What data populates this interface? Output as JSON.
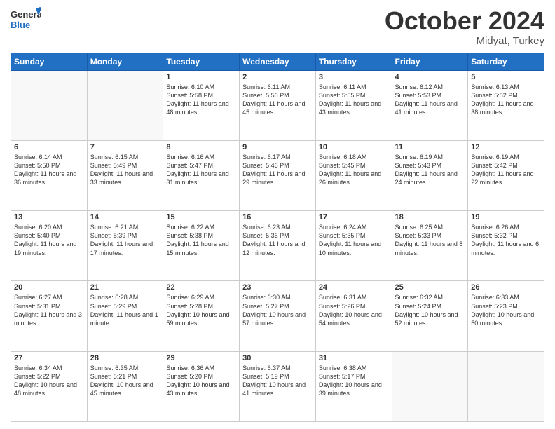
{
  "header": {
    "logo_general": "General",
    "logo_blue": "Blue",
    "month": "October 2024",
    "location": "Midyat, Turkey"
  },
  "days_of_week": [
    "Sunday",
    "Monday",
    "Tuesday",
    "Wednesday",
    "Thursday",
    "Friday",
    "Saturday"
  ],
  "weeks": [
    [
      {
        "day": "",
        "empty": true
      },
      {
        "day": "",
        "empty": true
      },
      {
        "day": "1",
        "sunrise": "6:10 AM",
        "sunset": "5:58 PM",
        "daylight": "11 hours and 48 minutes."
      },
      {
        "day": "2",
        "sunrise": "6:11 AM",
        "sunset": "5:56 PM",
        "daylight": "11 hours and 45 minutes."
      },
      {
        "day": "3",
        "sunrise": "6:11 AM",
        "sunset": "5:55 PM",
        "daylight": "11 hours and 43 minutes."
      },
      {
        "day": "4",
        "sunrise": "6:12 AM",
        "sunset": "5:53 PM",
        "daylight": "11 hours and 41 minutes."
      },
      {
        "day": "5",
        "sunrise": "6:13 AM",
        "sunset": "5:52 PM",
        "daylight": "11 hours and 38 minutes."
      }
    ],
    [
      {
        "day": "6",
        "sunrise": "6:14 AM",
        "sunset": "5:50 PM",
        "daylight": "11 hours and 36 minutes."
      },
      {
        "day": "7",
        "sunrise": "6:15 AM",
        "sunset": "5:49 PM",
        "daylight": "11 hours and 33 minutes."
      },
      {
        "day": "8",
        "sunrise": "6:16 AM",
        "sunset": "5:47 PM",
        "daylight": "11 hours and 31 minutes."
      },
      {
        "day": "9",
        "sunrise": "6:17 AM",
        "sunset": "5:46 PM",
        "daylight": "11 hours and 29 minutes."
      },
      {
        "day": "10",
        "sunrise": "6:18 AM",
        "sunset": "5:45 PM",
        "daylight": "11 hours and 26 minutes."
      },
      {
        "day": "11",
        "sunrise": "6:19 AM",
        "sunset": "5:43 PM",
        "daylight": "11 hours and 24 minutes."
      },
      {
        "day": "12",
        "sunrise": "6:19 AM",
        "sunset": "5:42 PM",
        "daylight": "11 hours and 22 minutes."
      }
    ],
    [
      {
        "day": "13",
        "sunrise": "6:20 AM",
        "sunset": "5:40 PM",
        "daylight": "11 hours and 19 minutes."
      },
      {
        "day": "14",
        "sunrise": "6:21 AM",
        "sunset": "5:39 PM",
        "daylight": "11 hours and 17 minutes."
      },
      {
        "day": "15",
        "sunrise": "6:22 AM",
        "sunset": "5:38 PM",
        "daylight": "11 hours and 15 minutes."
      },
      {
        "day": "16",
        "sunrise": "6:23 AM",
        "sunset": "5:36 PM",
        "daylight": "11 hours and 12 minutes."
      },
      {
        "day": "17",
        "sunrise": "6:24 AM",
        "sunset": "5:35 PM",
        "daylight": "11 hours and 10 minutes."
      },
      {
        "day": "18",
        "sunrise": "6:25 AM",
        "sunset": "5:33 PM",
        "daylight": "11 hours and 8 minutes."
      },
      {
        "day": "19",
        "sunrise": "6:26 AM",
        "sunset": "5:32 PM",
        "daylight": "11 hours and 6 minutes."
      }
    ],
    [
      {
        "day": "20",
        "sunrise": "6:27 AM",
        "sunset": "5:31 PM",
        "daylight": "11 hours and 3 minutes."
      },
      {
        "day": "21",
        "sunrise": "6:28 AM",
        "sunset": "5:29 PM",
        "daylight": "11 hours and 1 minute."
      },
      {
        "day": "22",
        "sunrise": "6:29 AM",
        "sunset": "5:28 PM",
        "daylight": "10 hours and 59 minutes."
      },
      {
        "day": "23",
        "sunrise": "6:30 AM",
        "sunset": "5:27 PM",
        "daylight": "10 hours and 57 minutes."
      },
      {
        "day": "24",
        "sunrise": "6:31 AM",
        "sunset": "5:26 PM",
        "daylight": "10 hours and 54 minutes."
      },
      {
        "day": "25",
        "sunrise": "6:32 AM",
        "sunset": "5:24 PM",
        "daylight": "10 hours and 52 minutes."
      },
      {
        "day": "26",
        "sunrise": "6:33 AM",
        "sunset": "5:23 PM",
        "daylight": "10 hours and 50 minutes."
      }
    ],
    [
      {
        "day": "27",
        "sunrise": "6:34 AM",
        "sunset": "5:22 PM",
        "daylight": "10 hours and 48 minutes."
      },
      {
        "day": "28",
        "sunrise": "6:35 AM",
        "sunset": "5:21 PM",
        "daylight": "10 hours and 45 minutes."
      },
      {
        "day": "29",
        "sunrise": "6:36 AM",
        "sunset": "5:20 PM",
        "daylight": "10 hours and 43 minutes."
      },
      {
        "day": "30",
        "sunrise": "6:37 AM",
        "sunset": "5:19 PM",
        "daylight": "10 hours and 41 minutes."
      },
      {
        "day": "31",
        "sunrise": "6:38 AM",
        "sunset": "5:17 PM",
        "daylight": "10 hours and 39 minutes."
      },
      {
        "day": "",
        "empty": true
      },
      {
        "day": "",
        "empty": true
      }
    ]
  ]
}
